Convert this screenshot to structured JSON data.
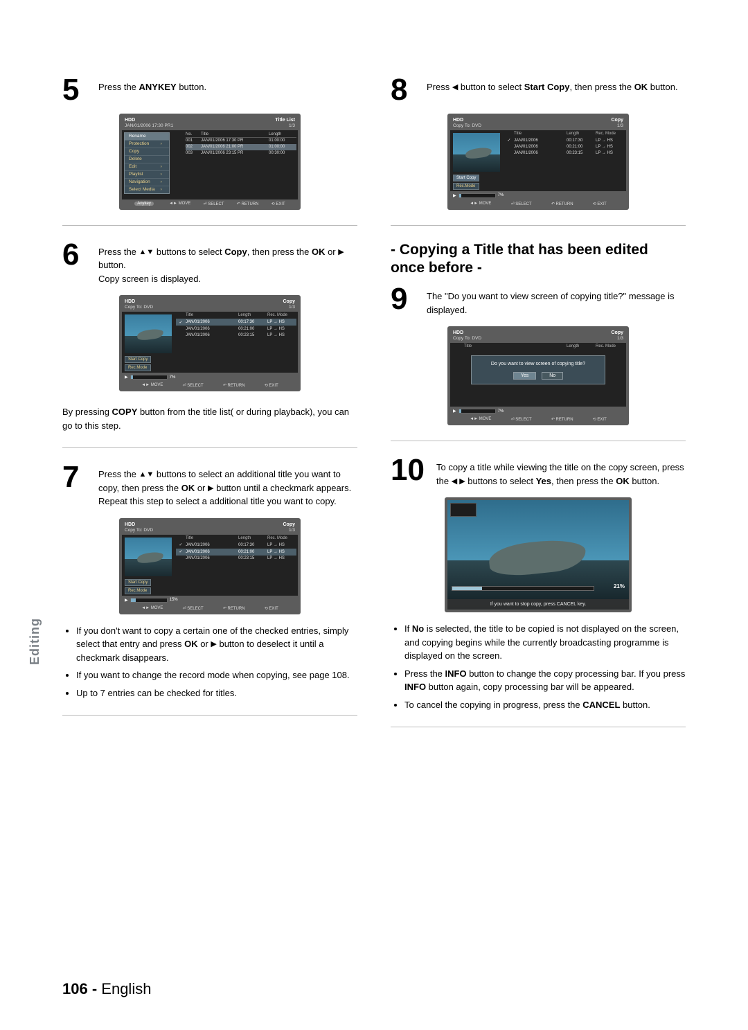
{
  "side_tab": "Editing",
  "footer": {
    "page": "106 -",
    "lang": "English"
  },
  "section_heading": "- Copying a Title that has been edited once before -",
  "steps": {
    "s5": {
      "num": "5",
      "text_pre": "Press the ",
      "bold": "ANYKEY",
      "text_post": " button."
    },
    "s6": {
      "num": "6",
      "line1_pre": "Press the ",
      "line1_mid": " buttons to select ",
      "line1_bold": "Copy",
      "line1_post": ", then press the ",
      "line2_bold": "OK",
      "line2_post": " or ",
      "line2_end": " button.",
      "line3": "Copy screen is displayed.",
      "note_pre": "By pressing ",
      "note_bold": "COPY",
      "note_post": " button from the title list( or during playback), you can go to this step."
    },
    "s7": {
      "num": "7",
      "text_pre": "Press the ",
      "text_mid": " buttons to select an additional title you want to copy, then press the ",
      "text_bold1": "OK",
      "text_or": " or ",
      "text_post": " button until a checkmark appears. Repeat this step to select a additional title you want to copy."
    },
    "s7_bullets": {
      "b1_pre": "If you don't want to copy a certain one of the checked entries, simply select that entry and press ",
      "b1_bold": "OK",
      "b1_or": " or ",
      "b1_post": " button to deselect it until a checkmark disappears.",
      "b2": "If you want to change the record mode when copying, see page 108.",
      "b3": "Up to 7 entries can be checked for titles."
    },
    "s8": {
      "num": "8",
      "pre": "Press ",
      "mid": " button to select ",
      "bold1": "Start Copy",
      "post1": ", then press the ",
      "bold2": "OK",
      "post2": " button."
    },
    "s9": {
      "num": "9",
      "line1": "The \"Do you want to view screen of copying title?\" message is displayed."
    },
    "s10": {
      "num": "10",
      "pre": "To copy a title while viewing the title on the copy screen, press the ",
      "mid": " buttons to select ",
      "bold1": "Yes",
      "post1": ", then press the ",
      "bold2": "OK",
      "post2": " button."
    },
    "s10_bullets": {
      "b1_pre": "If ",
      "b1_bold": "No",
      "b1_post": " is selected, the title to be copied is not displayed on the screen, and copying begins while the currently broadcasting programme is displayed on the screen.",
      "b2_pre": "Press the ",
      "b2_bold1": "INFO",
      "b2_mid": " button to change the copy processing bar.\nIf you press ",
      "b2_bold2": "INFO",
      "b2_post": " button again, copy processing bar will be appeared.",
      "b3_pre": "To cancel the copying in progress, press the ",
      "b3_bold": "CANCEL",
      "b3_post": " button."
    }
  },
  "ui_common": {
    "hdd": "HDD",
    "title_list": "Title List",
    "copy": "Copy",
    "copy_to": "Copy To: DVD",
    "page_counter": "1/3",
    "anykey": "Anykey",
    "foot_move": "MOVE",
    "foot_select": "SELECT",
    "foot_return": "RETURN",
    "foot_exit": "EXIT",
    "col_title": "Title",
    "col_length": "Length",
    "col_rec": "Rec. Mode",
    "col_no": "No.",
    "start_copy": "Start Copy",
    "rec_mode": "Rec.Mode"
  },
  "ui_step5": {
    "subline": "JAN/01/2006 17:30 PR1",
    "menu": [
      "Rename",
      "Protection",
      "Copy",
      "Delete",
      "Edit",
      "Playlist",
      "Navigation",
      "Select Media"
    ],
    "rows": [
      {
        "no": "001",
        "title": "JAN/01/2006 17:30 PR",
        "len": "01:00:00"
      },
      {
        "no": "002",
        "title": "JAN/01/2006 21:00 PR",
        "len": "01:00:00"
      },
      {
        "no": "003",
        "title": "JAN/01/2006 23:15 PR",
        "len": "00:30:00"
      }
    ]
  },
  "ui_copy_rows": [
    {
      "chk": "✓",
      "title": "JAN/01/2006",
      "len": "00:17:30",
      "mode": "LP → HS"
    },
    {
      "chk": "",
      "title": "JAN/01/2006",
      "len": "00:21:00",
      "mode": "LP → HS"
    },
    {
      "chk": "",
      "title": "JAN/01/2006",
      "len": "00:23:15",
      "mode": "LP → HS"
    }
  ],
  "ui_copy_progress": {
    "pct7": "7%",
    "pct15": "15%",
    "pct21": "21%"
  },
  "ui_dialog": {
    "msg": "Do you want to view screen of copying title?",
    "yes": "Yes",
    "no": "No"
  },
  "ui_playback": {
    "percent": "21%",
    "msg": "If you want to stop copy, press CANCEL key."
  }
}
